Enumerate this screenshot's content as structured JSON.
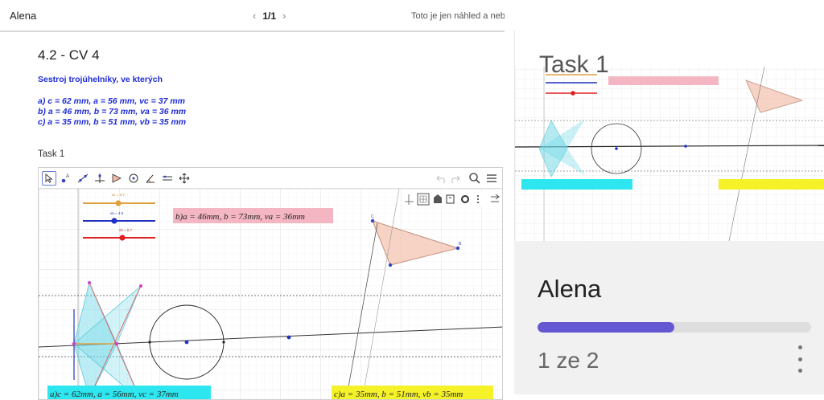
{
  "topbar": {
    "owner": "Alena",
    "page": "1/1",
    "prev_icon": "chevron-left-icon",
    "next_icon": "chevron-right-icon",
    "preview_note": "Toto je jen náhled a neb"
  },
  "document": {
    "title": "4.2 - CV 4",
    "instruction": "Sestroj trojúhelníky, ve kterých",
    "items": [
      "a) c = 62 mm, a = 56 mm, vc = 37 mm",
      "b) a = 46 mm, b = 73 mm, va = 36 mm",
      "c) a = 35 mm, b = 51 mm, vb = 35 mm"
    ],
    "task_label": "Task 1"
  },
  "applet": {
    "tools": [
      "move-tool-icon",
      "point-tool-icon",
      "line-tool-icon",
      "perpendicular-tool-icon",
      "polygon-tool-icon",
      "circle-tool-icon",
      "angle-tool-icon",
      "reflect-tool-icon",
      "slider-tool-icon",
      "move-view-tool-icon"
    ],
    "labels": {
      "a": "a)c = 62mm, a = 56mm, vc = 37mm",
      "b": "b)a = 46mm, b = 73mm, va = 36mm",
      "c": "c)a = 35mm, b = 51mm, vb = 35mm"
    },
    "colors": {
      "label_a_bg": "#2ee6f0",
      "label_b_bg": "#f4b6c2",
      "label_c_bg": "#f5f22a",
      "slider1": "#e0a040",
      "slider2": "#2030c0",
      "slider3": "#e02020"
    }
  },
  "thumbnail": {
    "title": "Task 1"
  },
  "card": {
    "name": "Alena",
    "progress": 0.5,
    "count": "1 ze 2",
    "menu_icon": "more-vertical-icon",
    "accent": "#6557d2"
  }
}
